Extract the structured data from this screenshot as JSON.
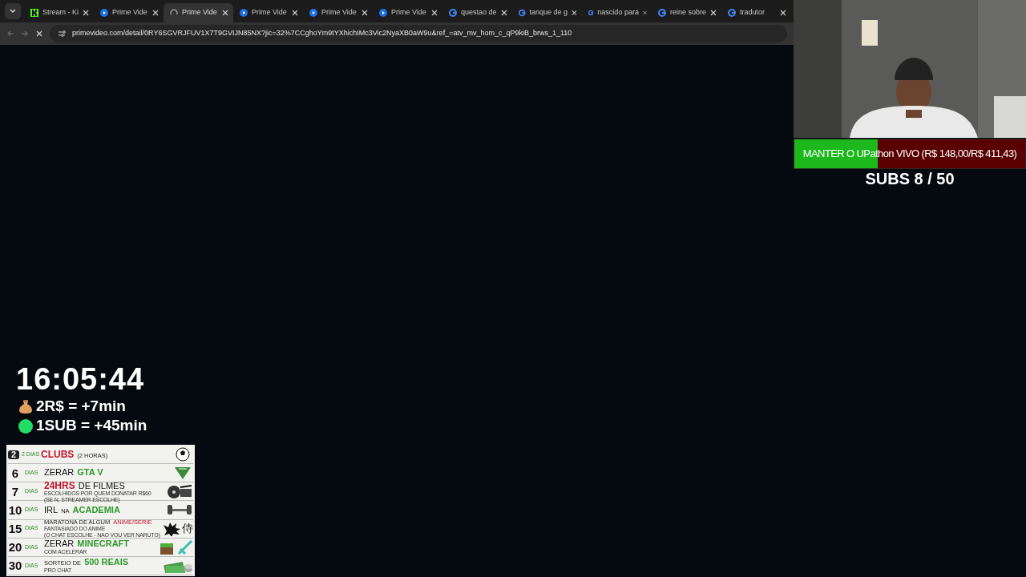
{
  "tabs": [
    {
      "label": "Stream - Ki",
      "kind": "kick",
      "selected": false
    },
    {
      "label": "Prime Vide",
      "kind": "prime",
      "selected": false
    },
    {
      "label": "Prime Vide",
      "kind": "loading",
      "selected": true
    },
    {
      "label": "Prime Vide",
      "kind": "prime",
      "selected": false
    },
    {
      "label": "Prime Vide",
      "kind": "prime",
      "selected": false
    },
    {
      "label": "Prime Vide",
      "kind": "prime",
      "selected": false
    },
    {
      "label": "questao de",
      "kind": "google",
      "selected": false
    },
    {
      "label": "tanque de g",
      "kind": "google",
      "selected": false
    },
    {
      "label": "nascido para",
      "kind": "google",
      "selected": false
    },
    {
      "label": "reine sobre",
      "kind": "google",
      "selected": false
    },
    {
      "label": "tradutor",
      "kind": "google",
      "selected": false
    }
  ],
  "address_bar": {
    "url": "primevideo.com/detail/0RY6SGVRJFUV1X7T9GVIJN85NX?jic=32%7CCghoYm9tYXhichIMc3Vic2NyaXB0aW9u&ref_=atv_mv_hom_c_qP9kiB_brws_1_110",
    "loading": true
  },
  "stream_overlay": {
    "goal_bar": {
      "label": "MANTER O UPathon VIVO (R$ 148,00/R$ 411,43)",
      "level": 0.36
    },
    "subs": "SUBS 8 / 50",
    "timer": "16:05:44",
    "rates": [
      {
        "kind": "money",
        "text": "2R$ = +7min"
      },
      {
        "kind": "sub",
        "text": "1SUB = +45min"
      }
    ],
    "goals": [
      {
        "number": "2",
        "badge": true,
        "unit": "2 DIAS",
        "title": [
          {
            "text": "CLUBS",
            "kind": "red"
          },
          {
            "text": "(2 HORAS)",
            "kind": "small"
          }
        ],
        "kind": "ball"
      },
      {
        "number": "6",
        "badge": false,
        "unit": "DIAS",
        "title": [
          {
            "text": "ZERAR",
            "kind": "plain"
          },
          {
            "text": "GTA V",
            "kind": "green"
          }
        ],
        "kind": "logo"
      },
      {
        "number": "7",
        "badge": false,
        "unit": "DIAS",
        "title": [
          {
            "text": "24HRS",
            "kind": "red"
          },
          {
            "text": "DE FILMES",
            "kind": "plain"
          }
        ],
        "notes": [
          "ESCOLHIDOS POR QUEM DONATAR R$60",
          "(SE N, STREAMER ESCOLHE)"
        ],
        "kind": "film"
      },
      {
        "number": "10",
        "badge": false,
        "unit": "DIAS",
        "title": [
          {
            "text": "IRL",
            "kind": "plain"
          },
          {
            "text": "NA",
            "kind": "small"
          },
          {
            "text": "ACADEMIA",
            "kind": "green"
          }
        ],
        "kind": "dumbbell"
      },
      {
        "number": "15",
        "badge": false,
        "unit": "DIAS",
        "title": [
          {
            "text": "MARATONA DE ALGUM",
            "kind": "small"
          },
          {
            "text": "ANIME/SERIE",
            "kind": "smallred"
          }
        ],
        "notes": [
          "FANTASIADO DO ANIME",
          "(O CHAT ESCOLHE - NAO VOU VER NARUTO)"
        ],
        "kind": "anime",
        "glyph": "侍"
      },
      {
        "number": "20",
        "badge": false,
        "unit": "DIAS",
        "title": [
          {
            "text": "ZERAR",
            "kind": "plain"
          },
          {
            "text": "MINECRAFT",
            "kind": "green"
          }
        ],
        "notes": [
          "COM ACELERAR"
        ],
        "kind": "block"
      },
      {
        "number": "30",
        "badge": false,
        "unit": "DIAS",
        "title": [
          {
            "text": "SORTEIO DE",
            "kind": "small"
          },
          {
            "text": "500 REAIS",
            "kind": "green"
          }
        ],
        "notes": [
          "PRO CHAT"
        ],
        "kind": "cash"
      }
    ]
  }
}
